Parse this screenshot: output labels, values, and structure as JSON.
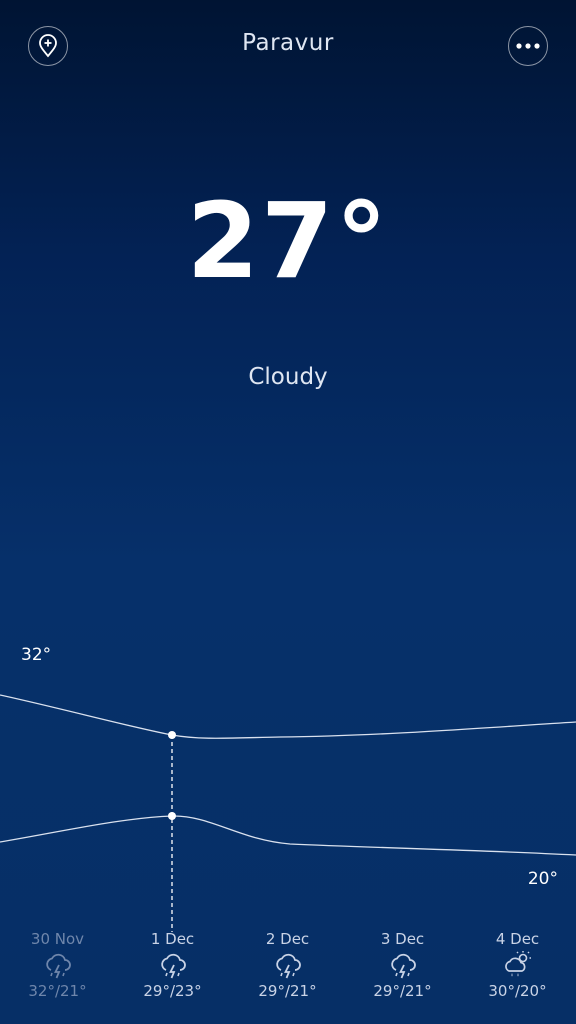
{
  "header": {
    "city": "Paravur",
    "add_icon": "add-location-icon",
    "more_icon": "more-icon"
  },
  "current": {
    "temperature": "27°",
    "condition": "Cloudy"
  },
  "graph": {
    "max_label": "32°",
    "min_label": "20°",
    "line_color": "#ffffff"
  },
  "forecast": [
    {
      "date": "30 Nov",
      "temps": "32°/21°",
      "icon": "thunder-rain-icon",
      "high": 32,
      "low": 21,
      "past": true
    },
    {
      "date": "1 Dec",
      "temps": "29°/23°",
      "icon": "thunder-rain-icon",
      "high": 29,
      "low": 23,
      "past": false
    },
    {
      "date": "2 Dec",
      "temps": "29°/21°",
      "icon": "thunder-rain-icon",
      "high": 29,
      "low": 21,
      "past": false
    },
    {
      "date": "3 Dec",
      "temps": "29°/21°",
      "icon": "thunder-rain-icon",
      "high": 29,
      "low": 21,
      "past": false
    },
    {
      "date": "4 Dec",
      "temps": "30°/20°",
      "icon": "sun-rain-icon",
      "high": 30,
      "low": 20,
      "past": false
    }
  ]
}
